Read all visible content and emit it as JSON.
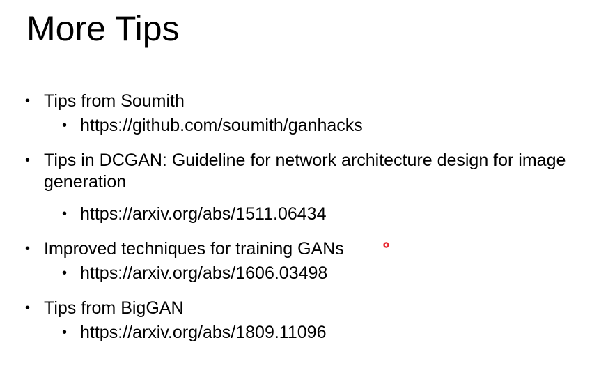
{
  "slide": {
    "title": "More Tips",
    "items": [
      {
        "text": "Tips from Soumith",
        "sub": "https://github.com/soumith/ganhacks"
      },
      {
        "text": "Tips in DCGAN: Guideline for network architecture design for image generation",
        "sub": "https://arxiv.org/abs/1511.06434"
      },
      {
        "text": "Improved techniques for training GANs",
        "sub": "https://arxiv.org/abs/1606.03498"
      },
      {
        "text": "Tips from BigGAN",
        "sub": "https://arxiv.org/abs/1809.11096"
      }
    ],
    "bullet_glyph": "•",
    "pointer_color": "#e8222a"
  }
}
